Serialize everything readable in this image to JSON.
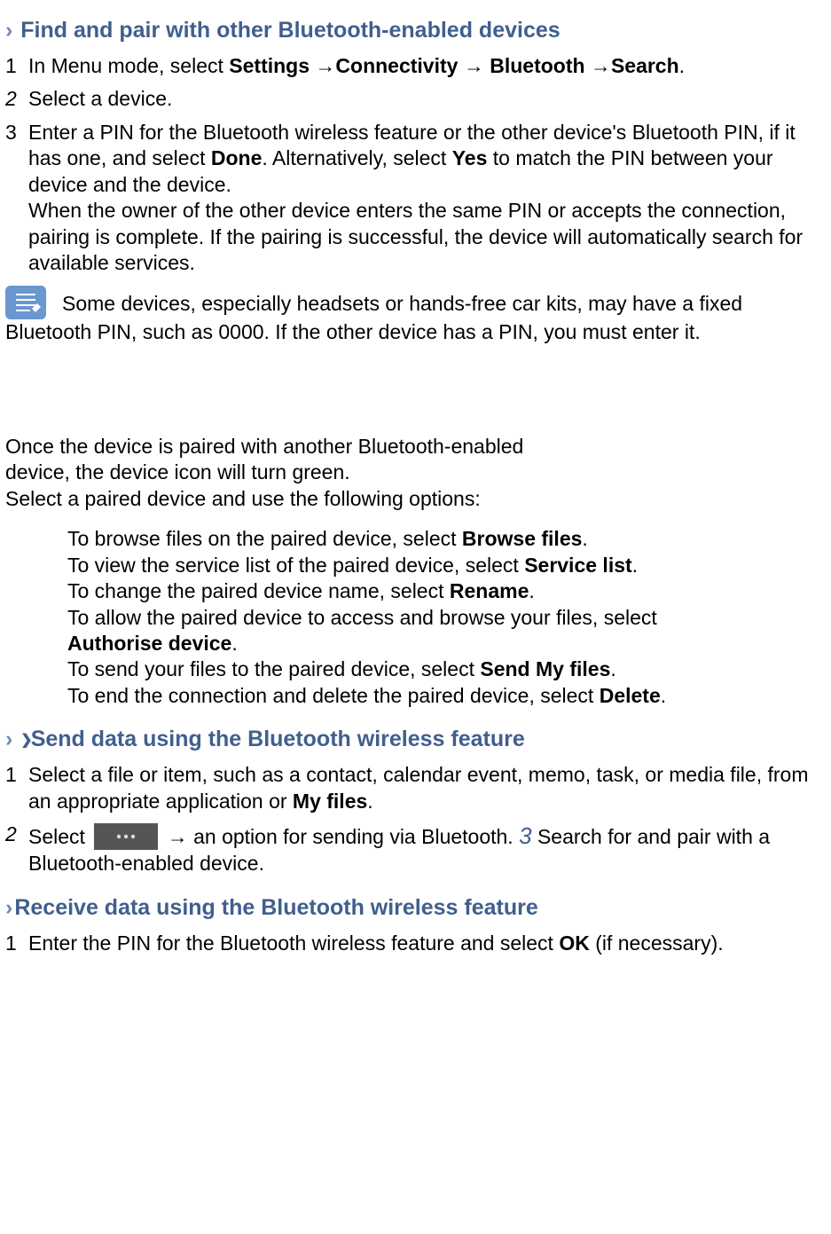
{
  "s1": {
    "heading": " Find and pair with other Bluetooth-enabled devices",
    "step1_pre": "In Menu mode, select ",
    "step1_b1": "Settings",
    "step1_mid1": " →",
    "step1_b2": "Connectivity",
    "step1_mid2": " → ",
    "step1_b3": "Bluetooth",
    "step1_mid3": " →",
    "step1_b4": "Search",
    "step1_post": ".",
    "step2": "Select a device.",
    "step3_a": "Enter a PIN for the Bluetooth wireless feature or the other device's Bluetooth PIN, if it has one, and select ",
    "step3_b1": "Done",
    "step3_b": ". Alternatively, select ",
    "step3_b2": "Yes",
    "step3_c": " to match the PIN between your device and the device.",
    "step3_d": "When the owner of the other device enters the same PIN or accepts the connection, pairing is complete. If the pairing is successful, the device will automatically search for available services.",
    "note": "Some devices, especially headsets or hands-free car kits, may have a fixed Bluetooth PIN, such as 0000. If the other device has a PIN, you must enter it.",
    "paired_intro_l1": "Once the device is paired with another Bluetooth-enabled",
    "paired_intro_l2": "device, the device icon will turn green.",
    "paired_intro_l3": "Select a paired device and use the following options:",
    "opt1a": "To browse files on the paired device, select ",
    "opt1b": "Browse files",
    "opt2a": "To view the service list of the paired device, select ",
    "opt2b": "Service list",
    "opt3a": "To change the paired device name, select ",
    "opt3b": "Rename",
    "opt4a": "To allow the paired device to access and browse your files, select ",
    "opt4b": "Authorise device",
    "opt5a": "To send your files to the paired device, select ",
    "opt5b": "Send My files",
    "opt6a": "To end the connection and delete the paired device, select ",
    "opt6b": "Delete"
  },
  "s2": {
    "heading": "Send data using the Bluetooth wireless feature",
    "step1a": "Select a file or item, such as a contact, calendar event, memo, task, or media file, from an appropriate application or ",
    "step1b": "My files",
    "step2a": "Select ",
    "step2b": "→ an option for sending via Bluetooth. ",
    "step2c": "3",
    "step2d": " Search for and pair with a Bluetooth-enabled device."
  },
  "s3": {
    "heading": "Receive data using the Bluetooth wireless feature",
    "step1a": "Enter the PIN for the Bluetooth wireless feature and select ",
    "step1b": "OK",
    "step1c": " (if necessary)."
  },
  "nums": {
    "n1": "1",
    "n2": "2",
    "n3": "3"
  }
}
